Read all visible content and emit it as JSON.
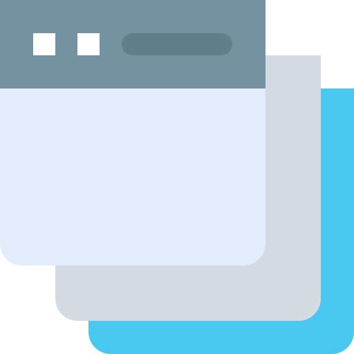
{
  "icon": {
    "name": "multiple-windows-icon",
    "colors": {
      "back_window": "#48C8EF",
      "middle_window": "#D5DCE1",
      "front_window_body": "#E3ECFA",
      "titlebar": "#7393A0",
      "window_buttons": "#FFFFFF",
      "address_bar": "#607F8B"
    }
  }
}
